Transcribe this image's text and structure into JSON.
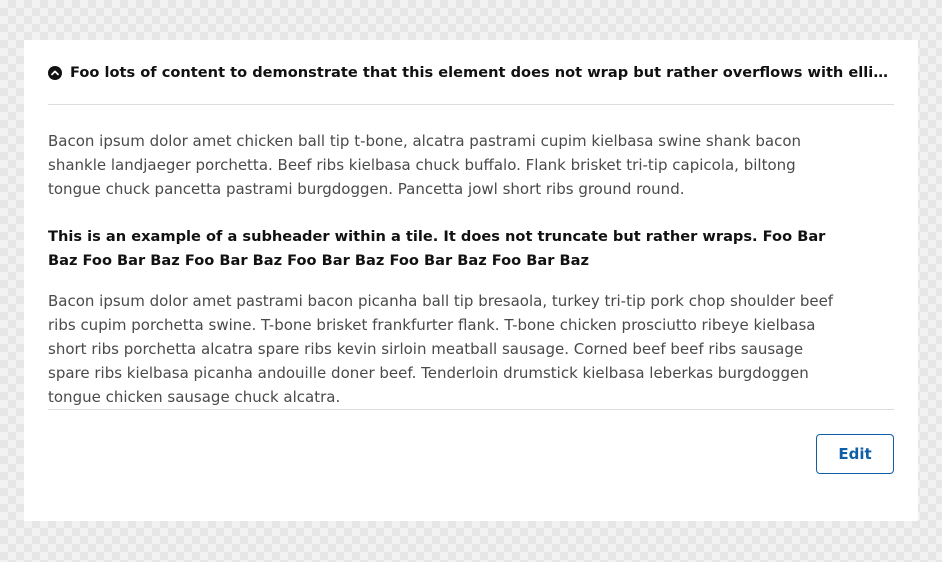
{
  "tile": {
    "header": {
      "icon": "chevron-up-circle-icon",
      "title": "Foo lots of content to demonstrate that this element does not wrap but rather overflows with ellipsis because it is a really long title"
    },
    "body": {
      "paragraph1": "Bacon ipsum dolor amet chicken ball tip t-bone, alcatra pastrami cupim kielbasa swine shank bacon shankle landjaeger porchetta. Beef ribs kielbasa chuck buffalo. Flank brisket tri-tip capicola, biltong tongue chuck pancetta pastrami burgdoggen. Pancetta jowl short ribs ground round.",
      "subheader": "This is an example of a subheader within a tile. It does not truncate but rather wraps. Foo Bar Baz Foo Bar Baz Foo Bar Baz Foo Bar Baz Foo Bar Baz Foo Bar Baz",
      "paragraph2": "Bacon ipsum dolor amet pastrami bacon picanha ball tip bresaola, turkey tri-tip pork chop shoulder beef ribs cupim porchetta swine. T-bone brisket frankfurter flank. T-bone chicken prosciutto ribeye kielbasa short ribs porchetta alcatra spare ribs kevin sirloin meatball sausage. Corned beef beef ribs sausage spare ribs kielbasa picanha andouille doner beef. Tenderloin drumstick kielbasa leberkas burgdoggen tongue chicken sausage chuck alcatra."
    },
    "footer": {
      "edit_label": "Edit"
    }
  },
  "colors": {
    "accent": "#0f5fa8",
    "title_text": "#111111",
    "body_text": "#4a4a4a",
    "divider": "#dddddd"
  }
}
